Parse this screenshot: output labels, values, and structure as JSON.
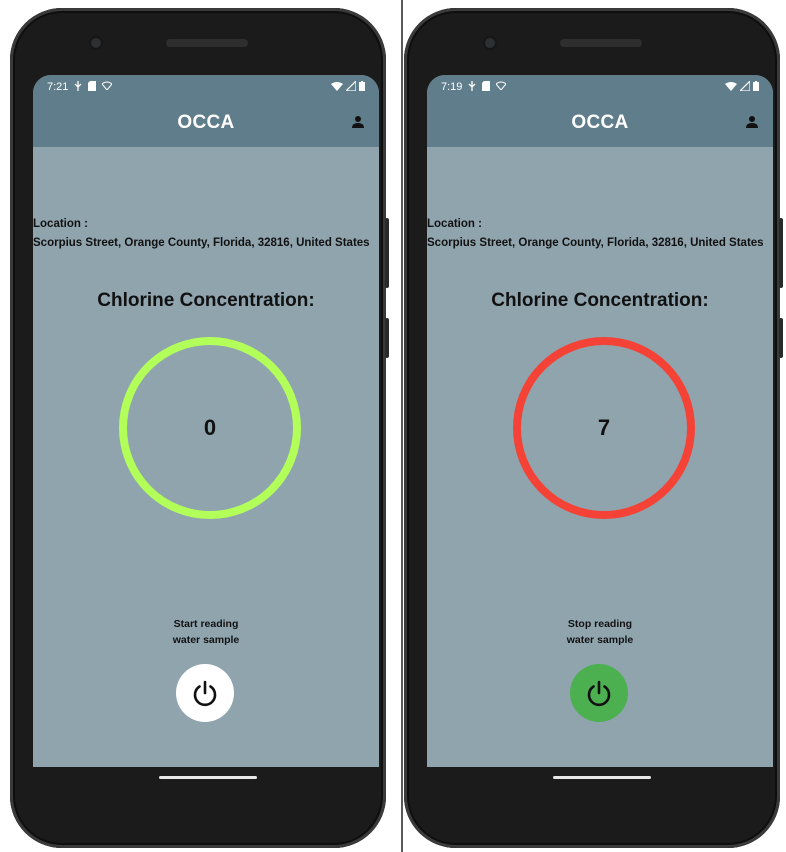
{
  "left_phone": {
    "status": {
      "time": "7:21"
    },
    "appbar": {
      "title": "OCCA"
    },
    "location": {
      "label": "Location :",
      "value": " Scorpius Street, Orange County, Florida, 32816, United States"
    },
    "heading": "Chlorine Concentration:",
    "reading": {
      "value": "0",
      "ring_color": "#b2ff59"
    },
    "action": {
      "line1": "Start reading",
      "line2": "water sample",
      "button_color": "#ffffff"
    }
  },
  "right_phone": {
    "status": {
      "time": "7:19"
    },
    "appbar": {
      "title": "OCCA"
    },
    "location": {
      "label": "Location :",
      "value": " Scorpius Street, Orange County, Florida, 32816, United States"
    },
    "heading": "Chlorine Concentration:",
    "reading": {
      "value": "7",
      "ring_color": "#f44336"
    },
    "action": {
      "line1": "Stop reading",
      "line2": "water sample",
      "button_color": "#4caf50"
    }
  },
  "theme": {
    "appbar_color": "#607d8b",
    "screen_bg": "#90a4ae"
  },
  "icons": [
    "usb-icon",
    "sim-icon",
    "wifi-icon",
    "signal-icon",
    "battery-icon",
    "person-icon",
    "power-icon"
  ]
}
